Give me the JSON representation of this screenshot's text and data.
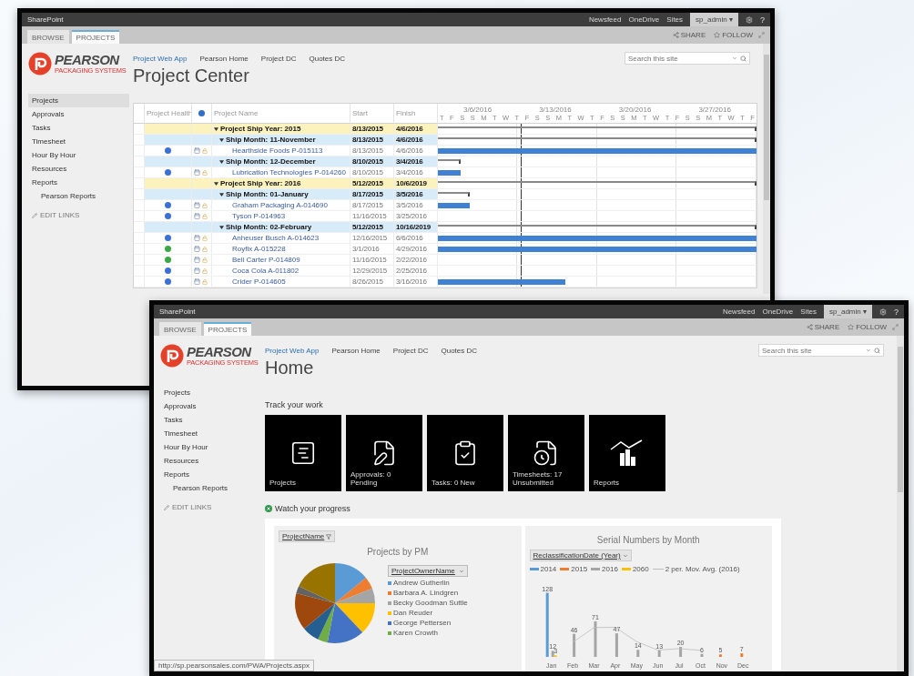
{
  "windows": [
    {
      "kind": "project_center",
      "app_name": "SharePoint",
      "top_links": [
        "Newsfeed",
        "OneDrive",
        "Sites"
      ],
      "user": "sp_admin ▾",
      "help": "?",
      "ribbon_tabs": [
        {
          "label": "BROWSE",
          "selected": false
        },
        {
          "label": "PROJECTS",
          "selected": true
        }
      ],
      "ribbon_actions": [
        "SHARE",
        "FOLLOW"
      ],
      "logo": {
        "name": "PEARSON",
        "tagline": "PACKAGING SYSTEMS"
      },
      "site_link": "Project Web App",
      "nav_links": [
        "Pearson Home",
        "Project DC",
        "Quotes DC"
      ],
      "title": "Project Center",
      "search": {
        "placeholder": "Search this site"
      },
      "sidebar": {
        "items": [
          {
            "label": "Projects",
            "selected": true
          },
          {
            "label": "Approvals",
            "selected": false
          },
          {
            "label": "Tasks",
            "selected": false
          },
          {
            "label": "Timesheet",
            "selected": false
          },
          {
            "label": "Hour By Hour",
            "selected": false
          },
          {
            "label": "Resources",
            "selected": false
          },
          {
            "label": "Reports",
            "selected": false,
            "children": [
              {
                "label": "Pearson Reports",
                "selected": false
              }
            ]
          }
        ],
        "edit_links": "EDIT LINKS"
      },
      "grid": {
        "columns": [
          "Project Health",
          "Project Name",
          "Start",
          "Finish"
        ],
        "timeline": {
          "weeks": [
            "3/6/2016",
            "3/13/2016",
            "3/20/2016",
            "3/27/2016"
          ],
          "days": [
            "T",
            "F",
            "S",
            "S",
            "M",
            "T",
            "W",
            "T",
            "F",
            "S",
            "S",
            "M",
            "T",
            "W",
            "T",
            "F",
            "S",
            "S",
            "M",
            "T",
            "W",
            "T",
            "F",
            "S",
            "S",
            "M",
            "T",
            "W",
            "T",
            "F"
          ]
        },
        "rows": [
          {
            "kind": "year",
            "name": "Project Ship Year: 2015",
            "start": "8/13/2015",
            "finish": "4/6/2016",
            "expanded": true,
            "bar": {
              "kind": "summary",
              "level": 1
            },
            "children": [
              {
                "kind": "month",
                "name": "Ship Month: 11-November",
                "start": "8/13/2015",
                "finish": "4/6/2016",
                "expanded": true,
                "bar": {
                  "kind": "summary",
                  "level": 1
                },
                "children": [
                  {
                    "kind": "project",
                    "name": "Hearthside Foods P-015113",
                    "start": "8/13/2015",
                    "finish": "4/6/2016",
                    "color": "#3b6fd6",
                    "bar": {
                      "kind": "task",
                      "level": 1
                    }
                  }
                ]
              },
              {
                "kind": "month",
                "name": "Ship Month: 12-December",
                "start": "8/10/2015",
                "finish": "3/4/2016",
                "expanded": true,
                "bar": {
                  "kind": "summary",
                  "level": 0.07
                },
                "children": [
                  {
                    "kind": "project",
                    "name": "Lubrication Technologies P-014260",
                    "start": "8/10/2015",
                    "finish": "3/4/2016",
                    "color": "#3b6fd6",
                    "bar": {
                      "kind": "task",
                      "level": 0.07
                    }
                  }
                ]
              }
            ]
          },
          {
            "kind": "year",
            "name": "Project Ship Year: 2016",
            "start": "5/12/2015",
            "finish": "10/6/2019",
            "expanded": true,
            "bar": {
              "kind": "summary",
              "level": 1
            },
            "children": [
              {
                "kind": "month",
                "name": "Ship Month: 01-January",
                "start": "8/17/2015",
                "finish": "3/5/2016",
                "expanded": true,
                "bar": {
                  "kind": "summary",
                  "level": 0.1
                },
                "children": [
                  {
                    "kind": "project",
                    "name": "Graham Packaging A-014690",
                    "start": "8/17/2015",
                    "finish": "3/5/2016",
                    "color": "#3b6fd6",
                    "bar": {
                      "kind": "task",
                      "level": 0.1
                    }
                  },
                  {
                    "kind": "project",
                    "name": "Tyson P-014963",
                    "start": "11/16/2015",
                    "finish": "3/25/2016",
                    "color": "#3b6fd6"
                  }
                ]
              },
              {
                "kind": "month",
                "name": "Ship Month: 02-February",
                "start": "5/12/2015",
                "finish": "10/16/2019",
                "expanded": true,
                "bar": {
                  "kind": "summary",
                  "level": 1
                },
                "children": [
                  {
                    "kind": "project",
                    "name": "Anheuser Busch A-014623",
                    "start": "12/16/2015",
                    "finish": "6/6/2016",
                    "color": "#3b6fd6",
                    "bar": {
                      "kind": "task",
                      "level": 1
                    }
                  },
                  {
                    "kind": "project",
                    "name": "Royfix A-015228",
                    "start": "3/1/2016",
                    "finish": "4/29/2016",
                    "color": "#3aa845",
                    "bar": {
                      "kind": "task",
                      "level": 1
                    }
                  },
                  {
                    "kind": "project",
                    "name": "Bell Carter P-014809",
                    "start": "11/16/2015",
                    "finish": "2/22/2016",
                    "color": "#3aa845"
                  },
                  {
                    "kind": "project",
                    "name": "Coca Cola A-011802",
                    "start": "12/29/2015",
                    "finish": "2/25/2016",
                    "color": "#3b6fd6"
                  },
                  {
                    "kind": "project",
                    "name": "Crider P-014605",
                    "start": "8/26/2015",
                    "finish": "3/16/2016",
                    "color": "#3b6fd6",
                    "bar": {
                      "kind": "task",
                      "level": 0.4
                    }
                  }
                ]
              }
            ]
          }
        ]
      }
    },
    {
      "kind": "home",
      "app_name": "SharePoint",
      "top_links": [
        "Newsfeed",
        "OneDrive",
        "Sites"
      ],
      "user": "sp_admin ▾",
      "help": "?",
      "ribbon_tabs": [
        {
          "label": "BROWSE",
          "selected": false
        },
        {
          "label": "PROJECTS",
          "selected": true
        }
      ],
      "ribbon_actions": [
        "SHARE",
        "FOLLOW"
      ],
      "logo": {
        "name": "PEARSON",
        "tagline": "PACKAGING SYSTEMS"
      },
      "site_link": "Project Web App",
      "nav_links": [
        "Pearson Home",
        "Project DC",
        "Quotes DC"
      ],
      "title": "Home",
      "search": {
        "placeholder": "Search this site"
      },
      "sidebar": {
        "items": [
          {
            "label": "Projects",
            "selected": false
          },
          {
            "label": "Approvals",
            "selected": false
          },
          {
            "label": "Tasks",
            "selected": false
          },
          {
            "label": "Timesheet",
            "selected": false
          },
          {
            "label": "Hour By Hour",
            "selected": false
          },
          {
            "label": "Resources",
            "selected": false
          },
          {
            "label": "Reports",
            "selected": false,
            "children": [
              {
                "label": "Pearson Reports",
                "selected": false
              }
            ]
          }
        ],
        "edit_links": "EDIT LINKS"
      },
      "track_title": "Track your work",
      "tiles": [
        {
          "kind": "projects",
          "label": "Projects"
        },
        {
          "kind": "approvals",
          "label": "Approvals: 0 Pending"
        },
        {
          "kind": "tasks",
          "label": "Tasks: 0 New"
        },
        {
          "kind": "timesheets",
          "label": "Timesheets: 17 Unsubmitted"
        },
        {
          "kind": "reports",
          "label": "Reports"
        }
      ],
      "progress_title": "Watch your progress",
      "pie_card": {
        "filter": "ProjectName",
        "title": "Projects by PM",
        "legend_title": "ProjectOwnerName",
        "legend": [
          {
            "name": "Andrew Gutherlin",
            "color": "#5b9bd5"
          },
          {
            "name": "Barbara A. Lindgren",
            "color": "#ed7d31"
          },
          {
            "name": "Becky Goodman Suttle",
            "color": "#a5a5a5"
          },
          {
            "name": "Dan Reuder",
            "color": "#ffc000"
          },
          {
            "name": "George Pettersen",
            "color": "#4472c4"
          },
          {
            "name": "Karen Crowth",
            "color": "#70ad47"
          }
        ]
      },
      "bar_card": {
        "title": "Serial Numbers by Month",
        "filter": "ReclassificationDate (Year)",
        "chart_data": {
          "type": "bar",
          "stacked": false,
          "categories": [
            "Jan",
            "Feb",
            "Mar",
            "Apr",
            "May",
            "Jun",
            "Jul",
            "Oct",
            "Nov",
            "Dec"
          ],
          "data_labels": true,
          "series": [
            {
              "name": "2014",
              "color": "#5b9bd5",
              "values": [
                128,
                null,
                null,
                null,
                null,
                null,
                null,
                null,
                null,
                null
              ]
            },
            {
              "name": "2015",
              "color": "#ed7d31",
              "values": [
                null,
                null,
                null,
                null,
                null,
                null,
                null,
                null,
                5,
                7
              ]
            },
            {
              "name": "2016",
              "color": "#a5a5a5",
              "values": [
                12,
                46,
                71,
                47,
                14,
                13,
                20,
                6,
                null,
                null
              ]
            },
            {
              "name": "2060",
              "color": "#ffc000",
              "values": [
                3,
                null,
                null,
                null,
                null,
                null,
                null,
                null,
                null,
                null
              ]
            }
          ]
        },
        "trendlines": [
          {
            "kind": "moving_average",
            "label": "2 per. Mov. Avg. (2016)",
            "color": "#bdbdbd"
          }
        ]
      },
      "status_url": "http://sp.pearsonsales.com/PWA/Projects.aspx"
    }
  ]
}
